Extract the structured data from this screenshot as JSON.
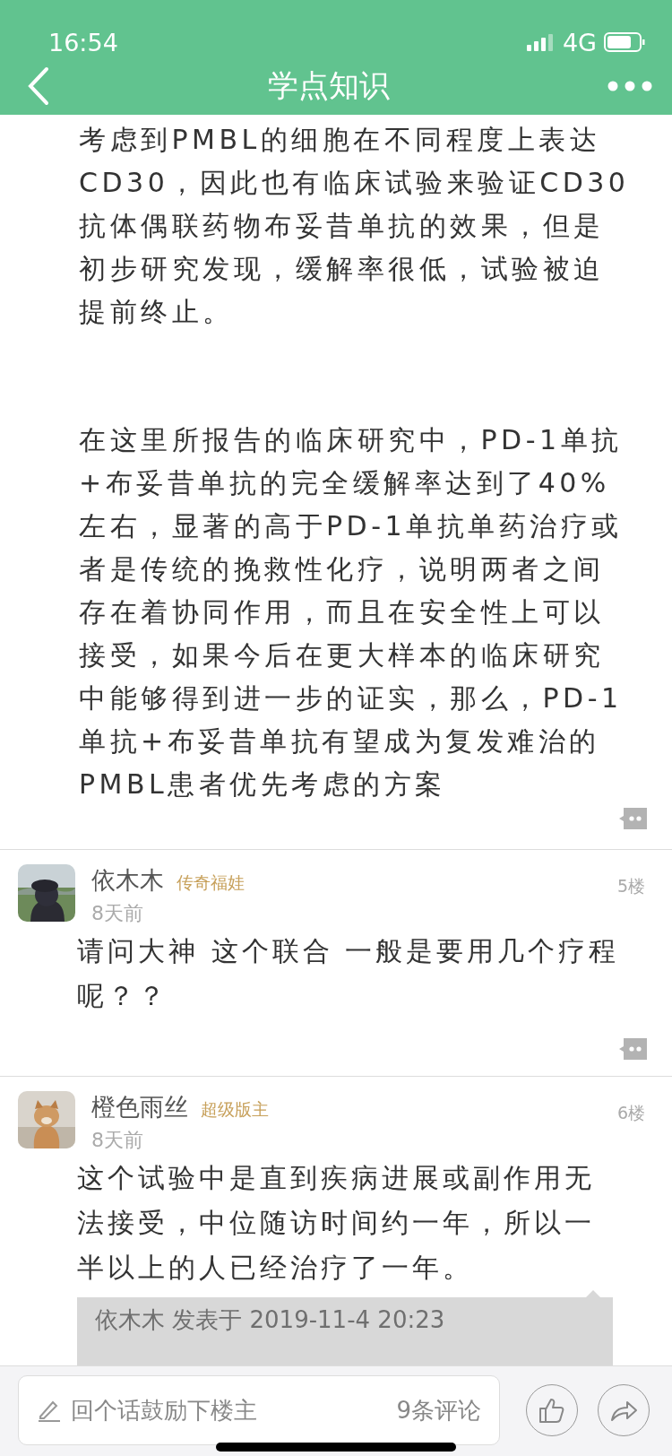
{
  "status_bar": {
    "time": "16:54",
    "network": "4G"
  },
  "header": {
    "title": "学点知识"
  },
  "post": {
    "paragraphs": [
      {
        "lines": [
          "考虑到PMBL的细胞在不同程度上表达",
          "CD30，因此也有临床试验来验证CD30",
          "抗体偶联药物布妥昔单抗的效果，但是",
          "初步研究发现，缓解率很低，试验被迫",
          "提前终止。"
        ]
      },
      {
        "lines": [
          "在这里所报告的临床研究中，PD-1单抗",
          "+布妥昔单抗的完全缓解率达到了40%",
          "左右，显著的高于PD-1单抗单药治疗或",
          "者是传统的挽救性化疗，说明两者之间",
          "存在着协同作用，而且在安全性上可以",
          "接受，如果今后在更大样本的临床研究",
          "中能够得到进一步的证实，那么，PD-1",
          "单抗+布妥昔单抗有望成为复发难治的",
          "PMBL患者优先考虑的方案"
        ]
      }
    ]
  },
  "comments": [
    {
      "user": "依木木",
      "role": "传奇福娃",
      "time": "8天前",
      "floor": "5楼",
      "lines": [
        "请问大神 这个联合 一般是要用几个疗程",
        "呢？？"
      ]
    },
    {
      "user": "橙色雨丝",
      "role": "超级版主",
      "time": "8天前",
      "floor": "6楼",
      "lines": [
        "这个试验中是直到疾病进展或副作用无",
        "法接受，中位随访时间约一年，所以一",
        "半以上的人已经治疗了一年。"
      ],
      "quote": "依木木 发表于 2019-11-4 20:23"
    }
  ],
  "bottom_bar": {
    "placeholder": "回个话鼓励下楼主",
    "comment_count": "9条评论"
  }
}
